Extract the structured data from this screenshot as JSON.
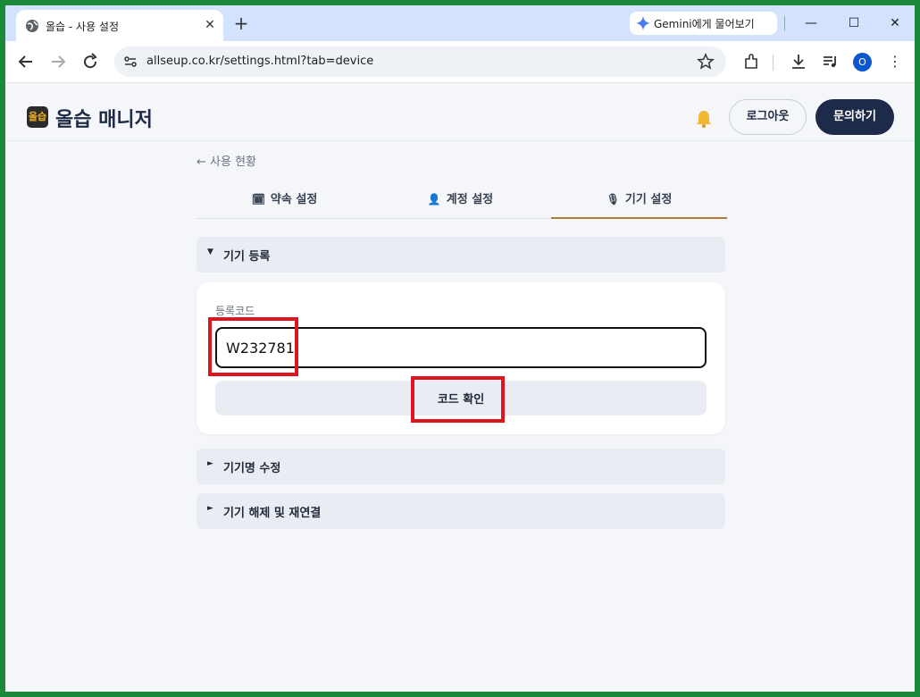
{
  "browser": {
    "tab_title": "올습 - 사용 설정",
    "close_glyph": "✕",
    "new_tab_glyph": "+",
    "gemini_label": "Gemini에게 물어보기",
    "url": "allseup.co.kr/settings.html?tab=device",
    "profile_initial": "O",
    "window_controls": {
      "minimize": "—",
      "maximize": "☐",
      "close": "✕"
    },
    "menu_glyph": "⋮"
  },
  "site": {
    "logo_text": "올습",
    "brand": "올습 매니저",
    "logout": "로그아웃",
    "contact": "문의하기"
  },
  "page": {
    "back_link": "← 사용 현황",
    "tabs": [
      {
        "icon": "🗓",
        "label": "약속 설정"
      },
      {
        "icon": "👤",
        "label": "계정 설정"
      },
      {
        "icon": "🎙",
        "label": "기기 설정"
      }
    ],
    "accordions": {
      "register": {
        "arrow": "▼",
        "title": "기기 등록"
      },
      "rename": {
        "arrow": "►",
        "title": "기기명 수정"
      },
      "unlink": {
        "arrow": "►",
        "title": "기기 해제 및 재연결"
      }
    },
    "register_form": {
      "field_label": "등록코드",
      "code_value": "W232781",
      "confirm_label": "코드 확인"
    }
  },
  "colors": {
    "accent_tab": "#b07b3a",
    "contact_bg": "#1e2a4a",
    "highlight": "#e0141e"
  }
}
